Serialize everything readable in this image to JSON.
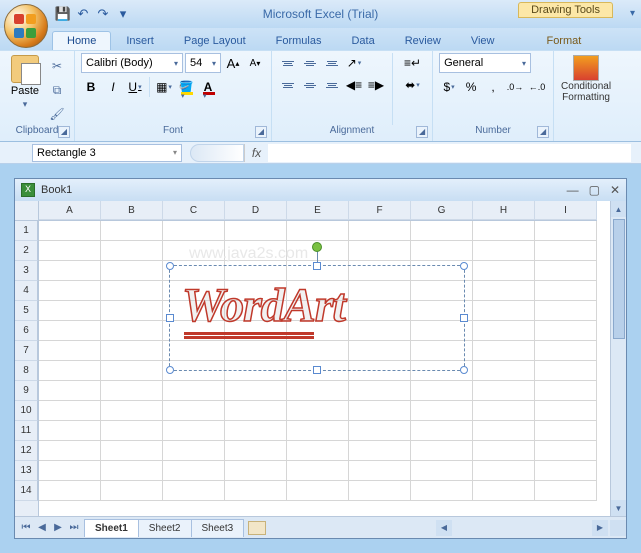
{
  "app": {
    "title": "Microsoft Excel (Trial)",
    "context_group": "Drawing Tools"
  },
  "qat": {
    "save": "💾",
    "undo": "↶",
    "redo": "↷"
  },
  "tabs": {
    "home": "Home",
    "insert": "Insert",
    "page_layout": "Page Layout",
    "formulas": "Formulas",
    "data": "Data",
    "review": "Review",
    "view": "View",
    "format": "Format"
  },
  "ribbon": {
    "clipboard": {
      "label": "Clipboard",
      "paste": "Paste"
    },
    "font": {
      "label": "Font",
      "name": "Calibri (Body)",
      "size": "54",
      "grow": "A",
      "shrink": "A",
      "bold": "B",
      "italic": "I",
      "underline": "U"
    },
    "alignment": {
      "label": "Alignment",
      "wrap": "Wrap Text",
      "merge": "Merge"
    },
    "number": {
      "label": "Number",
      "format": "General",
      "currency": "$",
      "percent": "%",
      "comma": ",",
      "inc_dec": "←.0",
      "dec_dec": ".00→"
    },
    "styles": {
      "conditional": "Conditional Formatting"
    }
  },
  "formula_bar": {
    "name_box": "Rectangle 3",
    "fx": "fx",
    "value": ""
  },
  "workbook": {
    "title": "Book1",
    "columns": [
      "A",
      "B",
      "C",
      "D",
      "E",
      "F",
      "G",
      "H",
      "I"
    ],
    "rows": [
      "1",
      "2",
      "3",
      "4",
      "5",
      "6",
      "7",
      "8",
      "9",
      "10",
      "11",
      "12",
      "13",
      "14"
    ],
    "watermark": "www.java2s.com",
    "wordart": "WordArt",
    "sheets": {
      "s1": "Sheet1",
      "s2": "Sheet2",
      "s3": "Sheet3"
    }
  }
}
